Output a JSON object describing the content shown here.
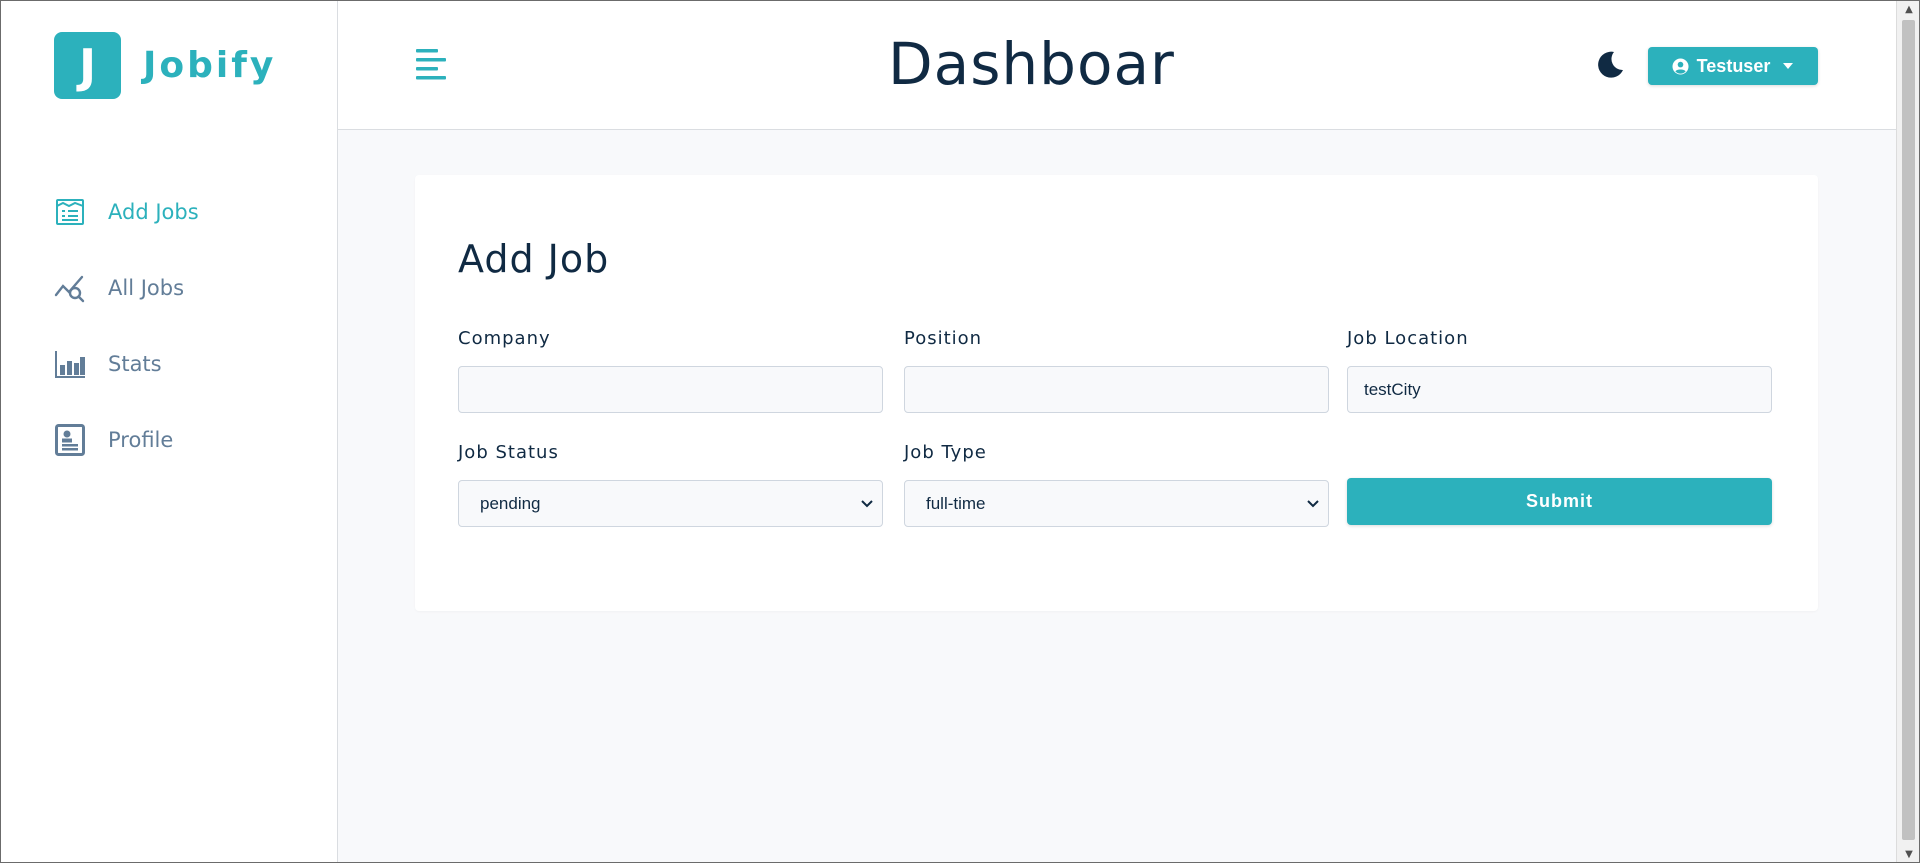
{
  "brand": {
    "logo_letter": "J",
    "name": "Jobify"
  },
  "header": {
    "title": "Dashboar",
    "user_name": "Testuser"
  },
  "nav": {
    "items": [
      {
        "label": "Add Jobs",
        "icon": "form-icon",
        "active": true
      },
      {
        "label": "All Jobs",
        "icon": "query-stats-icon",
        "active": false
      },
      {
        "label": "Stats",
        "icon": "bar-chart-icon",
        "active": false
      },
      {
        "label": "Profile",
        "icon": "profile-icon",
        "active": false
      }
    ]
  },
  "form": {
    "title": "Add Job",
    "company": {
      "label": "Company",
      "value": ""
    },
    "position": {
      "label": "Position",
      "value": ""
    },
    "location": {
      "label": "Job Location",
      "value": "testCity"
    },
    "status": {
      "label": "Job Status",
      "value": "pending"
    },
    "type": {
      "label": "Job Type",
      "value": "full-time"
    },
    "submit_label": "Submit"
  },
  "colors": {
    "primary": "#2cb1bc",
    "text": "#102a43",
    "muted": "#627d98",
    "background": "#f8f9fb"
  }
}
